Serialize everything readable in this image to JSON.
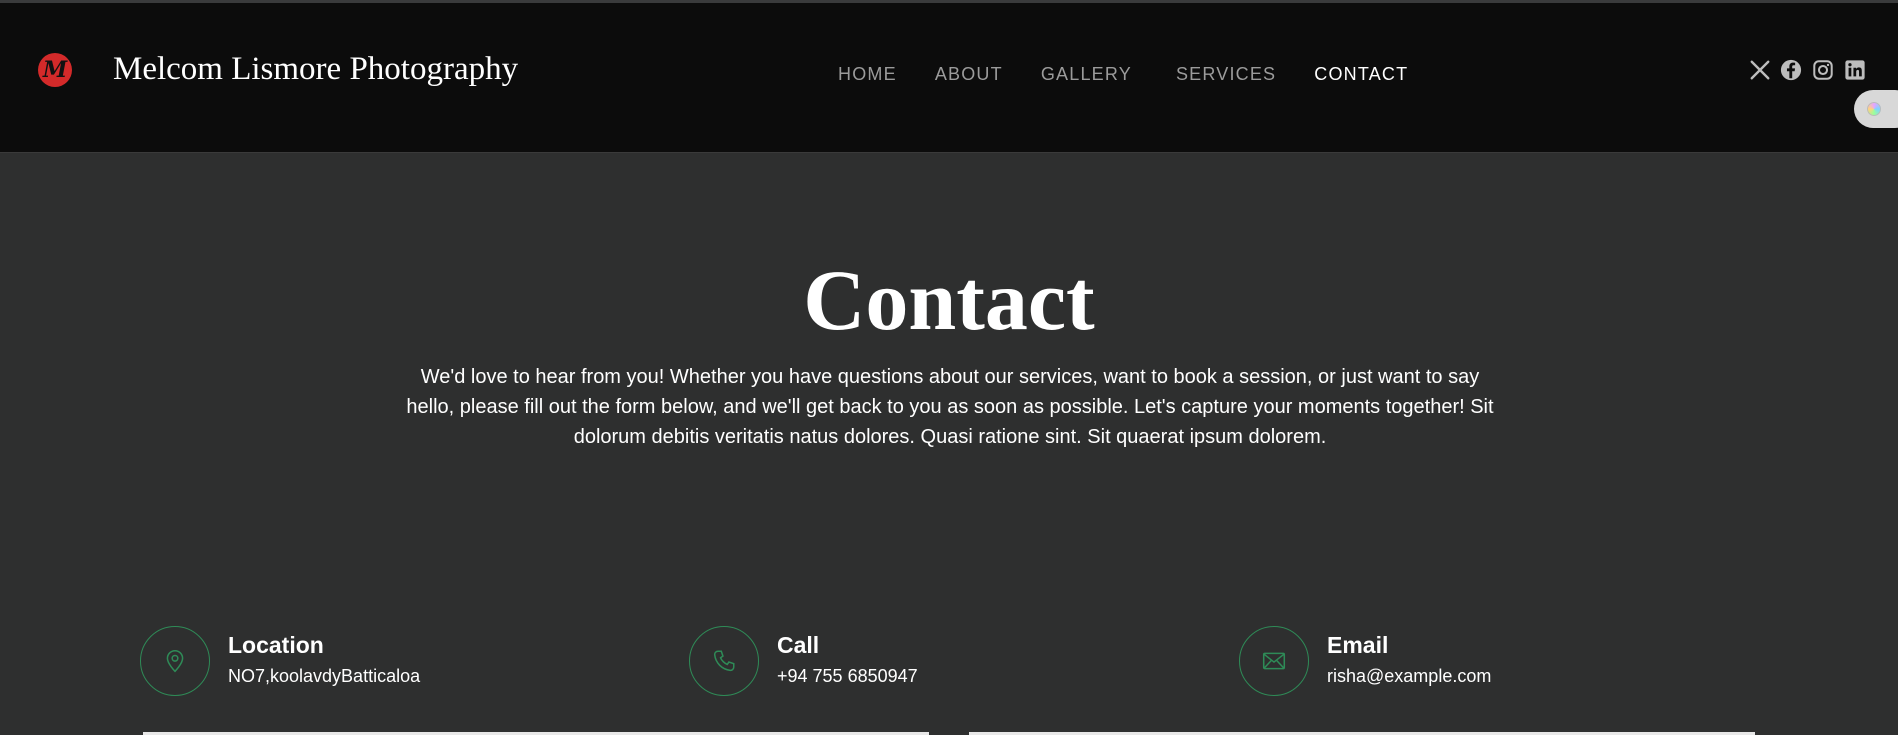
{
  "header": {
    "logo_letter": "M",
    "brand": "Melcom Lismore Photography",
    "nav": [
      {
        "label": "HOME",
        "active": false
      },
      {
        "label": "ABOUT",
        "active": false
      },
      {
        "label": "GALLERY",
        "active": false
      },
      {
        "label": "SERVICES",
        "active": false
      },
      {
        "label": "CONTACT",
        "active": true
      }
    ],
    "social": [
      "x-icon",
      "facebook-icon",
      "instagram-icon",
      "linkedin-icon"
    ]
  },
  "hero": {
    "title": "Contact",
    "text": "We'd love to hear from you! Whether you have questions about our services, want to book a session, or just want to say hello, please fill out the form below, and we'll get back to you as soon as possible. Let's capture your moments together! Sit dolorum debitis veritatis natus dolores. Quasi ratione sint. Sit quaerat ipsum dolorem."
  },
  "info": [
    {
      "icon": "map-pin-icon",
      "title": "Location",
      "value": "NO7,koolavdyBatticaloa"
    },
    {
      "icon": "phone-icon",
      "title": "Call",
      "value": "+94 755 6850947"
    },
    {
      "icon": "envelope-icon",
      "title": "Email",
      "value": "risha@example.com"
    }
  ],
  "colors": {
    "header_bg": "#0c0c0c",
    "page_bg": "#2e2f2f",
    "accent_green": "#2e8b57",
    "logo_red": "#d42a2a",
    "nav_inactive": "#9b9b9b"
  }
}
